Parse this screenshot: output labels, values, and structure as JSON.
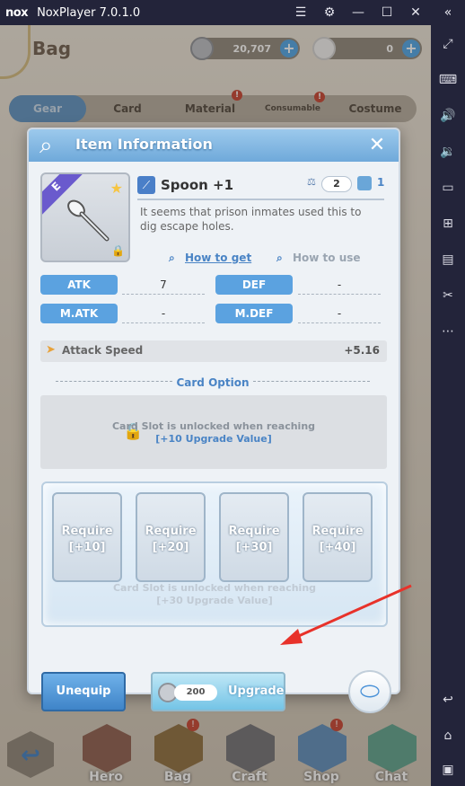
{
  "window": {
    "logo": "nox",
    "title": "NoxPlayer 7.0.1.0"
  },
  "game": {
    "screen_title": "Bag",
    "currency1": "20,707",
    "currency2": "0",
    "tabs": [
      {
        "label": "Gear"
      },
      {
        "label": "Card"
      },
      {
        "label": "Material",
        "badge": "!"
      },
      {
        "label": "Consumable",
        "badge": "!"
      },
      {
        "label": "Costume"
      }
    ],
    "nav": [
      {
        "label": "Hero"
      },
      {
        "label": "Bag",
        "badge": "!"
      },
      {
        "label": "Craft"
      },
      {
        "label": "Shop",
        "badge": "!"
      },
      {
        "label": "Chat"
      }
    ]
  },
  "dialog": {
    "title": "Item Information",
    "item": {
      "grade": "E",
      "name": "Spoon +1",
      "weight": "2",
      "count": "1",
      "description": "It seems that prison inmates used this to dig escape holes."
    },
    "how_to_get": "How to get",
    "how_to_use": "How to use",
    "stats": [
      {
        "label": "ATK",
        "value": "7"
      },
      {
        "label": "DEF",
        "value": "-"
      },
      {
        "label": "M.ATK",
        "value": "-"
      },
      {
        "label": "M.DEF",
        "value": "-"
      }
    ],
    "attack_speed": {
      "label": "Attack Speed",
      "value": "+5.16"
    },
    "card_option": "Card Option",
    "slot": {
      "line1": "Card Slot is unlocked when reaching",
      "line2": "[+10 Upgrade Value]"
    },
    "requires": [
      {
        "line1": "Require",
        "line2": "[+10]"
      },
      {
        "line1": "Require",
        "line2": "[+20]"
      },
      {
        "line1": "Require",
        "line2": "[+30]"
      },
      {
        "line1": "Require",
        "line2": "[+40]"
      }
    ],
    "ghost": {
      "line1": "Card Slot is unlocked when reaching",
      "line2": "[+30 Upgrade Value]"
    },
    "unequip": "Unequip",
    "upgrade_cost": "200",
    "upgrade": "Upgrade"
  }
}
